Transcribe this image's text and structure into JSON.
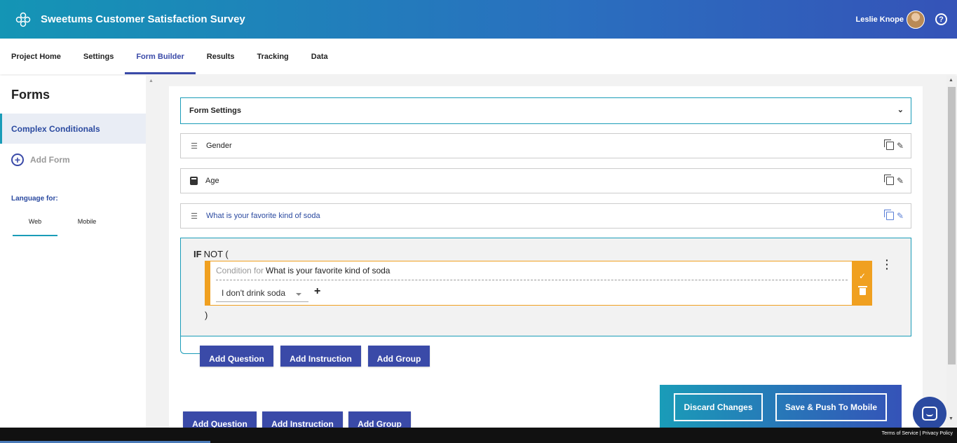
{
  "header": {
    "app_title": "Sweetums Customer Satisfaction Survey",
    "user_name": "Leslie Knope",
    "help_glyph": "?",
    "logo_icon": "flower-logo-icon"
  },
  "nav": {
    "tabs": [
      {
        "label": "Project Home",
        "active": false
      },
      {
        "label": "Settings",
        "active": false
      },
      {
        "label": "Form Builder",
        "active": true
      },
      {
        "label": "Results",
        "active": false
      },
      {
        "label": "Tracking",
        "active": false
      },
      {
        "label": "Data",
        "active": false
      }
    ]
  },
  "sidebar": {
    "title": "Forms",
    "active_form": "Complex Conditionals",
    "add_form_label": "Add Form",
    "language_label": "Language for:",
    "language_tabs": [
      {
        "label": "Web",
        "active": true
      },
      {
        "label": "Mobile",
        "active": false
      }
    ]
  },
  "builder": {
    "form_settings_label": "Form Settings",
    "questions": [
      {
        "label": "Gender",
        "icon": "list-icon"
      },
      {
        "label": "Age",
        "icon": "calculator-icon"
      },
      {
        "label": "What is your favorite kind of soda",
        "icon": "list-icon"
      }
    ],
    "condition": {
      "if_keyword": "IF",
      "operator": "NOT (",
      "close": ")",
      "condition_for_prefix": "Condition for",
      "condition_for_question": "What is your favorite kind of soda",
      "selected_option": "I don't drink soda",
      "add_symbol": "+"
    },
    "inner_buttons": {
      "add_question": "Add Question",
      "add_instruction": "Add Instruction",
      "add_group": "Add Group"
    },
    "outer_buttons": {
      "add_question": "Add Question",
      "add_instruction": "Add Instruction",
      "add_group": "Add Group"
    }
  },
  "save_bar": {
    "discard_label": "Discard Changes",
    "save_label": "Save & Push To Mobile"
  },
  "footer": {
    "terms": "Terms of Service",
    "separator": "|",
    "privacy": "Privacy Policy"
  },
  "colors": {
    "primary": "#3a4aa8",
    "teal": "#1a9cb8",
    "condition_accent": "#f0a020"
  }
}
